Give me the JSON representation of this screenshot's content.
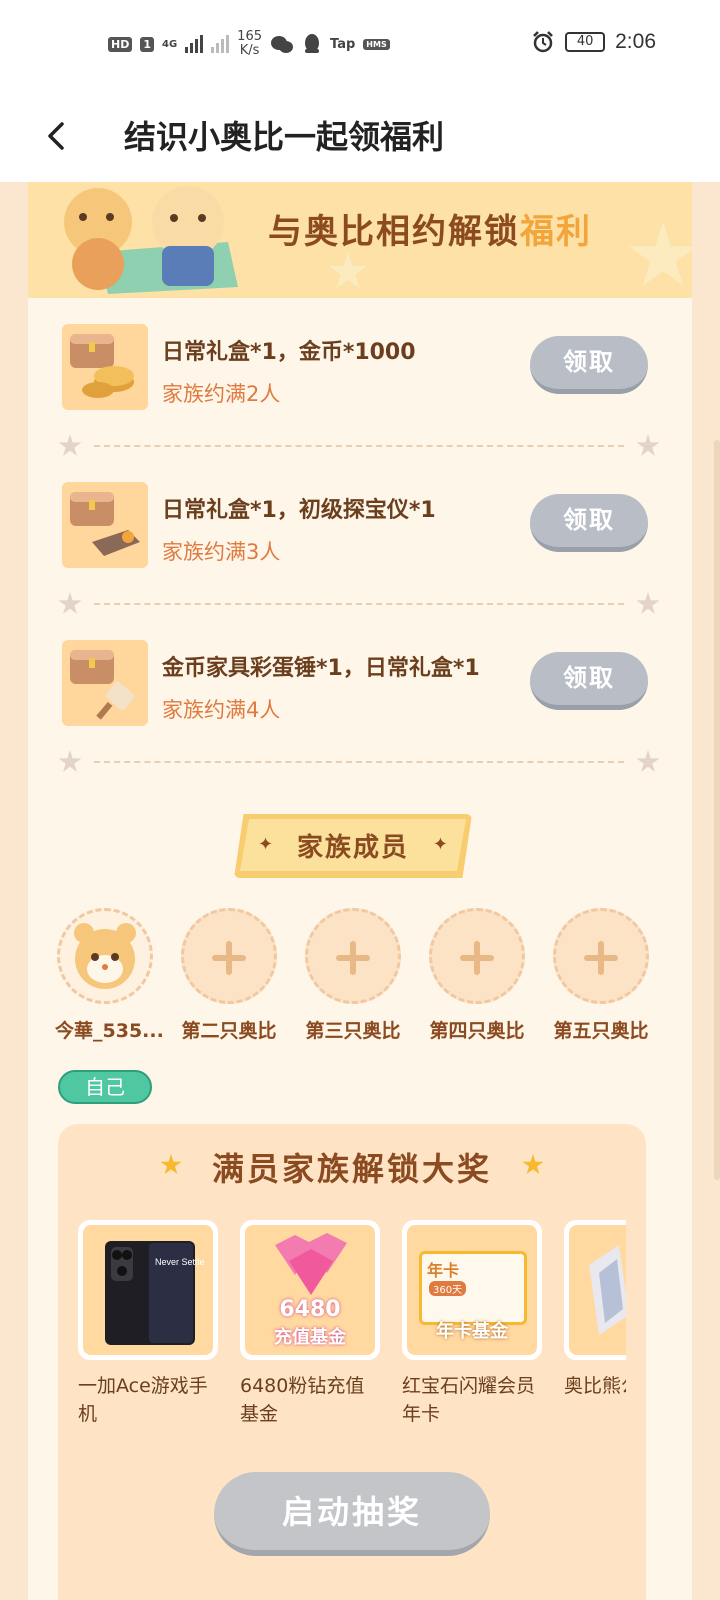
{
  "status_bar": {
    "hd": "HD",
    "sim": "1",
    "network": "4G",
    "speed_value": "165",
    "speed_unit": "K/s",
    "tap": "Tap",
    "hms": "HMS",
    "battery": "40",
    "time": "2:06"
  },
  "header": {
    "title": "结识小奥比一起领福利"
  },
  "banner": {
    "title_main": "与奥比相约解锁",
    "title_highlight": "福利"
  },
  "rewards": [
    {
      "name": "日常礼盒*1，金币*1000",
      "condition": "家族约满2人",
      "button": "领取"
    },
    {
      "name": "日常礼盒*1，初级探宝仪*1",
      "condition": "家族约满3人",
      "button": "领取"
    },
    {
      "name": "金币家具彩蛋锤*1，日常礼盒*1",
      "condition": "家族约满4人",
      "button": "领取"
    }
  ],
  "members_section": {
    "title": "家族成员",
    "members": [
      {
        "label": "今華_535..."
      },
      {
        "label": "第二只奥比"
      },
      {
        "label": "第三只奥比"
      },
      {
        "label": "第四只奥比"
      },
      {
        "label": "第五只奥比"
      }
    ],
    "self_badge": "自己"
  },
  "prize_section": {
    "title": "满员家族解锁大奖",
    "prizes": [
      {
        "name": "一加Ace游戏手机",
        "card_text": "Never Settle"
      },
      {
        "name": "6480粉钻充值基金",
        "card_text_top": "6480",
        "card_text_bottom": "充值基金"
      },
      {
        "name": "红宝石闪耀会员年卡",
        "card_text_top": "年卡",
        "card_text_days": "360天",
        "card_text_bottom": "年卡基金"
      },
      {
        "name": "奥比熊公"
      }
    ],
    "draw_button": "启动抽奖"
  },
  "colors": {
    "accent_brown": "#8b4a1f",
    "condition_orange": "#e07a3e",
    "disabled_gray": "#b9bec6",
    "self_green": "#4fc7a0"
  }
}
